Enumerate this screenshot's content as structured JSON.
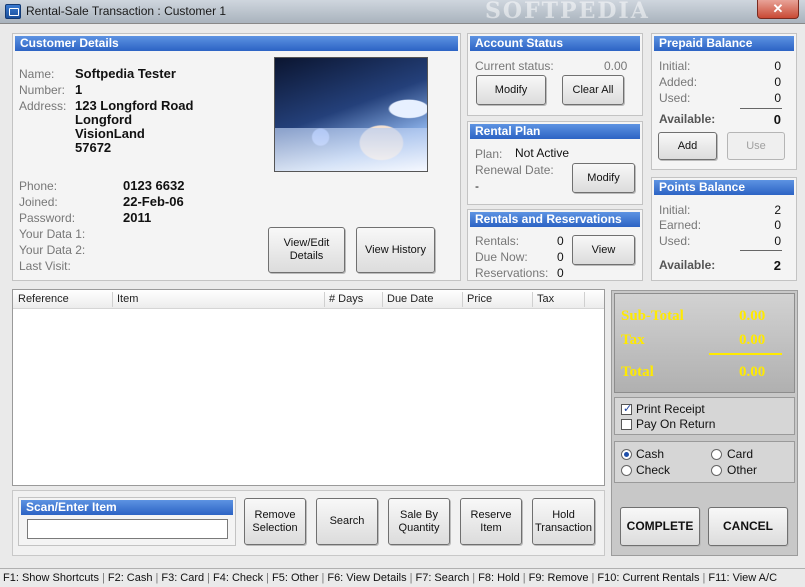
{
  "window": {
    "title": "Rental-Sale Transaction : Customer 1",
    "watermark": "SOFTPEDIA",
    "close": "✕"
  },
  "customer": {
    "header": "Customer Details",
    "name_label": "Name:",
    "name": "Softpedia Tester",
    "number_label": "Number:",
    "number": "1",
    "address_label": "Address:",
    "address_lines": [
      "123 Longford Road",
      "Longford",
      "VisionLand",
      "57672"
    ],
    "phone_label": "Phone:",
    "phone": "0123 6632",
    "joined_label": "Joined:",
    "joined": "22-Feb-06",
    "password_label": "Password:",
    "password": "2011",
    "data1_label": "Your Data 1:",
    "data2_label": "Your Data 2:",
    "last_visit_label": "Last Visit:",
    "view_edit_label": "View/Edit\nDetails",
    "view_history_label": "View History"
  },
  "account_status": {
    "header": "Account Status",
    "current_label": "Current status:",
    "current_value": "0.00",
    "modify_label": "Modify",
    "clear_all_label": "Clear All"
  },
  "rental_plan": {
    "header": "Rental Plan",
    "plan_label": "Plan:",
    "plan_value": "Not Active",
    "renewal_label": "Renewal Date:",
    "renewal_value": "-",
    "modify_label": "Modify"
  },
  "rentals": {
    "header": "Rentals and Reservations",
    "rentals_label": "Rentals:",
    "rentals_value": "0",
    "due_label": "Due Now:",
    "due_value": "0",
    "reservations_label": "Reservations:",
    "reservations_value": "0",
    "view_label": "View"
  },
  "prepaid": {
    "header": "Prepaid Balance",
    "initial_label": "Initial:",
    "initial_value": "0",
    "added_label": "Added:",
    "added_value": "0",
    "used_label": "Used:",
    "used_value": "0",
    "available_label": "Available:",
    "available_value": "0",
    "add_label": "Add",
    "use_label": "Use"
  },
  "points": {
    "header": "Points Balance",
    "initial_label": "Initial:",
    "initial_value": "2",
    "earned_label": "Earned:",
    "earned_value": "0",
    "used_label": "Used:",
    "used_value": "0",
    "available_label": "Available:",
    "available_value": "2"
  },
  "grid": {
    "columns": [
      "Reference",
      "Item",
      "# Days",
      "Due Date",
      "Price",
      "Tax"
    ]
  },
  "scan": {
    "header": "Scan/Enter Item",
    "value": ""
  },
  "actions": {
    "remove_selection": "Remove\nSelection",
    "search": "Search",
    "sale_by_quantity": "Sale By\nQuantity",
    "reserve_item": "Reserve\nItem",
    "hold_transaction": "Hold\nTransaction"
  },
  "totals": {
    "subtotal_label": "Sub-Total",
    "subtotal_value": "0.00",
    "tax_label": "Tax",
    "tax_value": "0.00",
    "total_label": "Total",
    "total_value": "0.00",
    "print_receipt_label": "Print Receipt",
    "print_receipt_checked": true,
    "pay_on_return_label": "Pay On Return",
    "pay_on_return_checked": false,
    "payment_options": [
      "Cash",
      "Card",
      "Check",
      "Other"
    ],
    "payment_selected": "Cash",
    "complete_label": "COMPLETE",
    "cancel_label": "CANCEL"
  },
  "statusbar": [
    "F1: Show Shortcuts",
    "F2: Cash",
    "F3: Card",
    "F4: Check",
    "F5: Other",
    "F6: View Details",
    "F7: Search",
    "F8: Hold",
    "F9: Remove",
    "F10: Current Rentals",
    "F11: View A/C"
  ]
}
